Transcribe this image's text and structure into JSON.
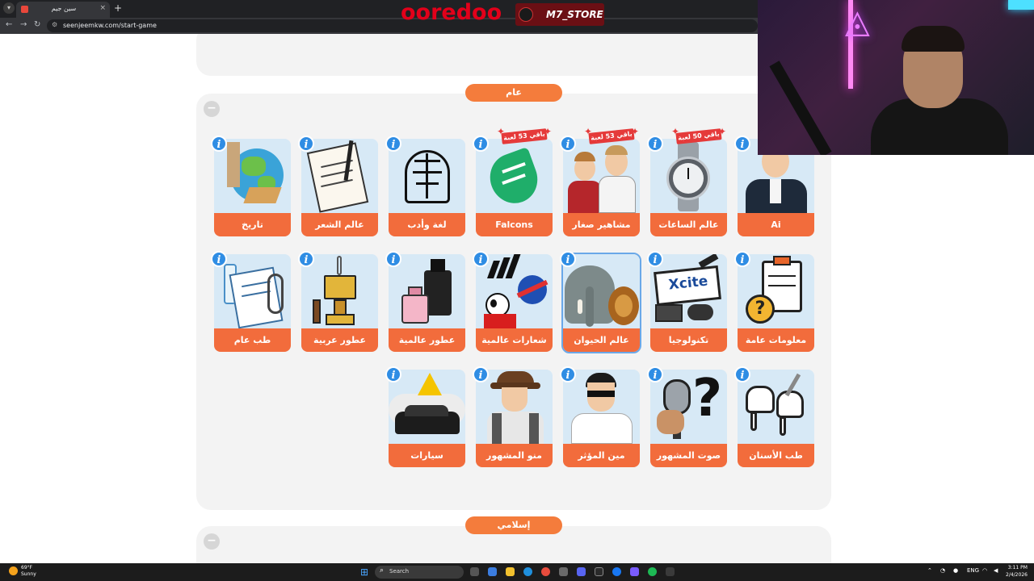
{
  "browser": {
    "tab_title": "سين جيم",
    "url": "seenjeemkw.com/start-game",
    "new_tab": "+",
    "close": "×"
  },
  "overlay": {
    "brand": "ooredoo",
    "store": "M7_STORE"
  },
  "sections": [
    {
      "title": "عام"
    },
    {
      "title": "إسلامي"
    }
  ],
  "collapse_symbol": "−",
  "info_symbol": "i",
  "cards_row1": [
    {
      "label": "تاريخ"
    },
    {
      "label": "عالم الشعر"
    },
    {
      "label": "لغة وأدب"
    },
    {
      "label": "Falcons",
      "badge": "باقي 53 لعبة"
    },
    {
      "label": "مشاهير صغار",
      "badge": "باقي 53 لعبة"
    },
    {
      "label": "عالم الساعات",
      "badge": "باقي 50 لعبة"
    },
    {
      "label": "Ai"
    }
  ],
  "cards_row2": [
    {
      "label": "طب عام"
    },
    {
      "label": "عطور عربية"
    },
    {
      "label": "عطور عالمية"
    },
    {
      "label": "شعارات عالمية"
    },
    {
      "label": "عالم الحيوان"
    },
    {
      "label": "تكنولوجيا",
      "art_text": "Xcite"
    },
    {
      "label": "معلومات عامة"
    }
  ],
  "cards_row3": [
    {
      "label": "سيارات"
    },
    {
      "label": "منو المشهور"
    },
    {
      "label": "مين المؤثر"
    },
    {
      "label": "صوت المشهور"
    },
    {
      "label": "طب الأسنان"
    }
  ],
  "taskbar": {
    "temp": "69°F",
    "weather": "Sunny",
    "search": "Search",
    "lang": "ENG",
    "time": "3:11 PM",
    "date": "2/4/2026"
  },
  "colors": {
    "accent": "#f26c3c",
    "info": "#2f8de4",
    "badge": "#e53a3a",
    "panel": "#f3f3f3"
  }
}
